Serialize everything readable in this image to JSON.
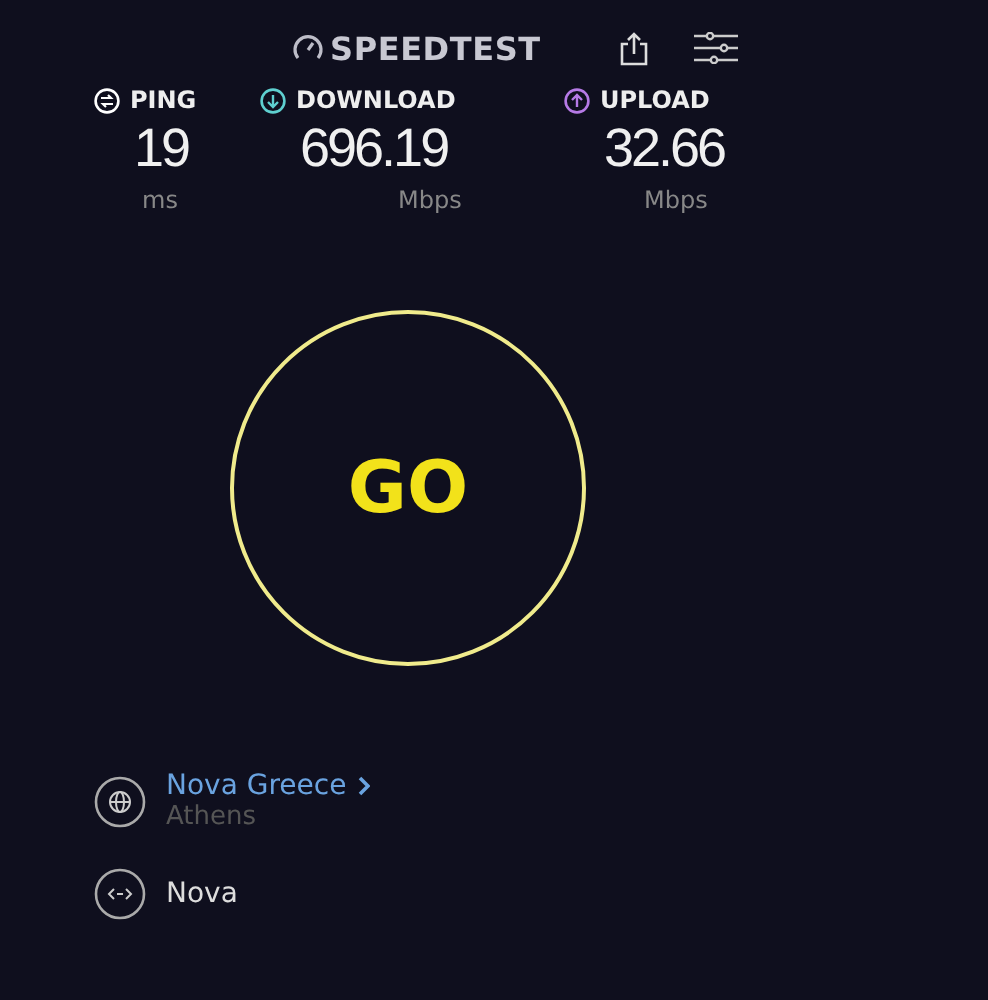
{
  "header": {
    "logo": "SPEEDTEST"
  },
  "metrics": [
    {
      "kind": "ping",
      "label": "PING",
      "value": "19",
      "unit": "ms",
      "color": "#ffffff"
    },
    {
      "kind": "download",
      "label": "DOWNLOAD",
      "value": "696.19",
      "unit": "Mbps",
      "color": "#5fd0d0"
    },
    {
      "kind": "upload",
      "label": "UPLOAD",
      "value": "32.66",
      "unit": "Mbps",
      "color": "#b67ae6"
    }
  ],
  "go_button": "GO",
  "server": {
    "name": "Nova Greece",
    "city": "Athens"
  },
  "provider": {
    "name": "Nova"
  }
}
